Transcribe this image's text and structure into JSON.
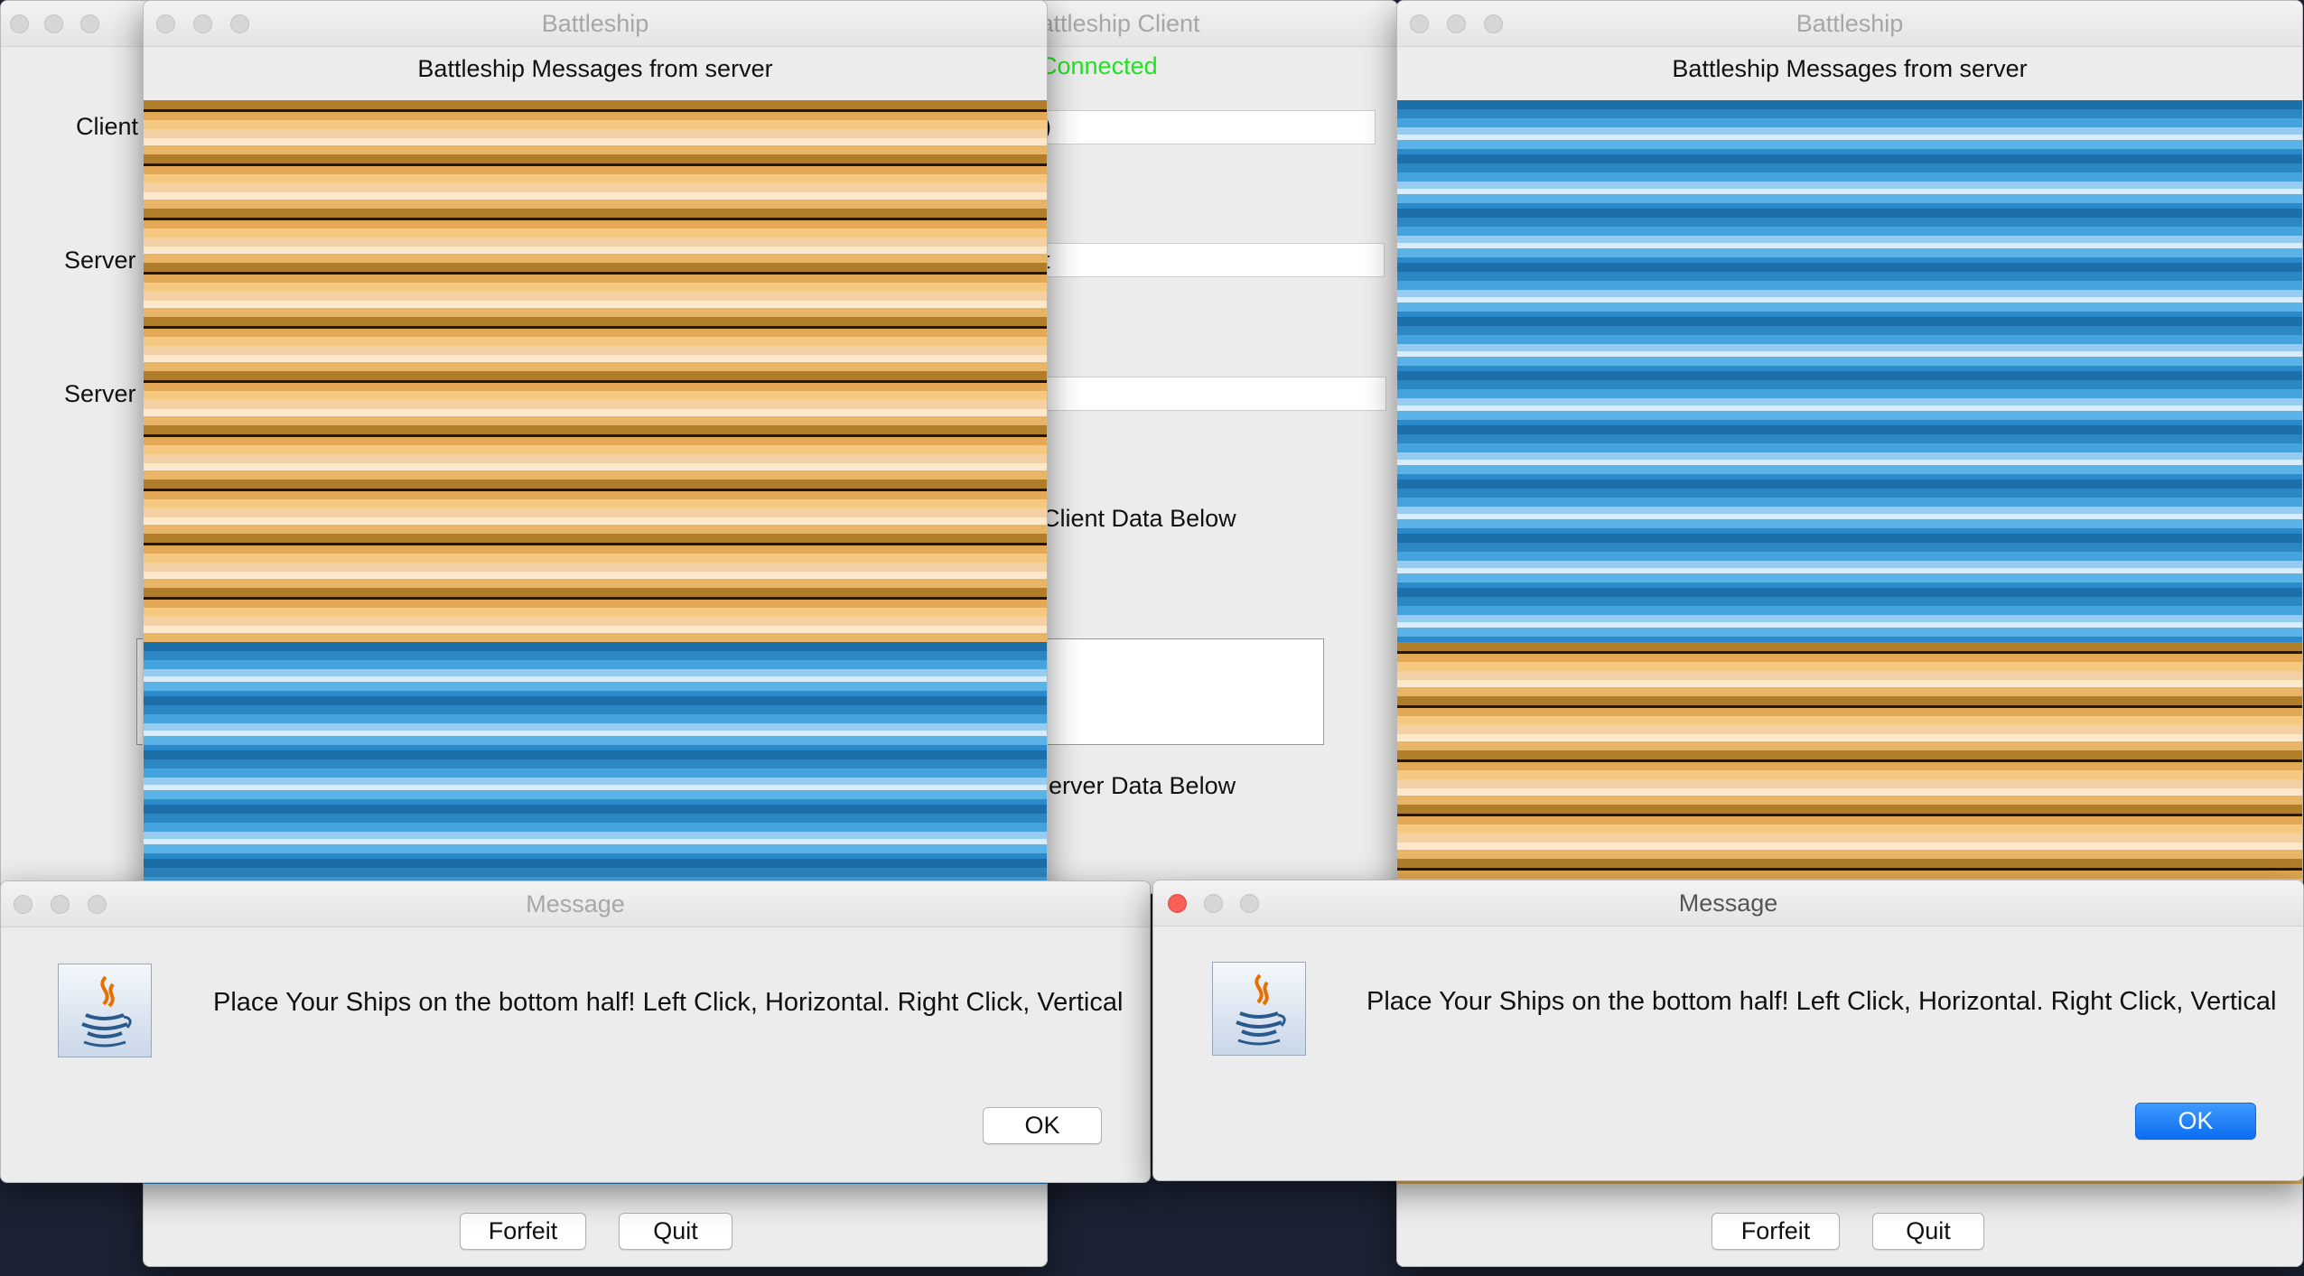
{
  "client_window": {
    "title": "Battleship Client",
    "status": "Connected",
    "status_color": "#22e022",
    "client_label": "Client",
    "server_label_1": "Server I",
    "server_label_2": "Server I",
    "field_1_value": ")",
    "field_2_value": "t",
    "client_data_label": "Client Data Below",
    "server_data_label": "erver Data Below"
  },
  "board_left": {
    "title": "Battleship",
    "header": "Battleship Messages from server",
    "forfeit_label": "Forfeit",
    "quit_label": "Quit"
  },
  "board_right": {
    "title": "Battleship",
    "header": "Battleship Messages from server",
    "forfeit_label": "Forfeit",
    "quit_label": "Quit"
  },
  "dialog_left": {
    "title": "Message",
    "text": "Place Your Ships on the bottom half! Left Click, Horizontal. Right Click, Vertical",
    "ok_label": "OK",
    "icon": "java-icon"
  },
  "dialog_right": {
    "title": "Message",
    "text": "Place Your Ships on the bottom half! Left Click, Horizontal. Right Click, Vertical",
    "ok_label": "OK",
    "icon": "java-icon"
  },
  "colors": {
    "sand": "#e3a855",
    "water": "#2c86c2",
    "ok_button": "#0a6cf0"
  }
}
